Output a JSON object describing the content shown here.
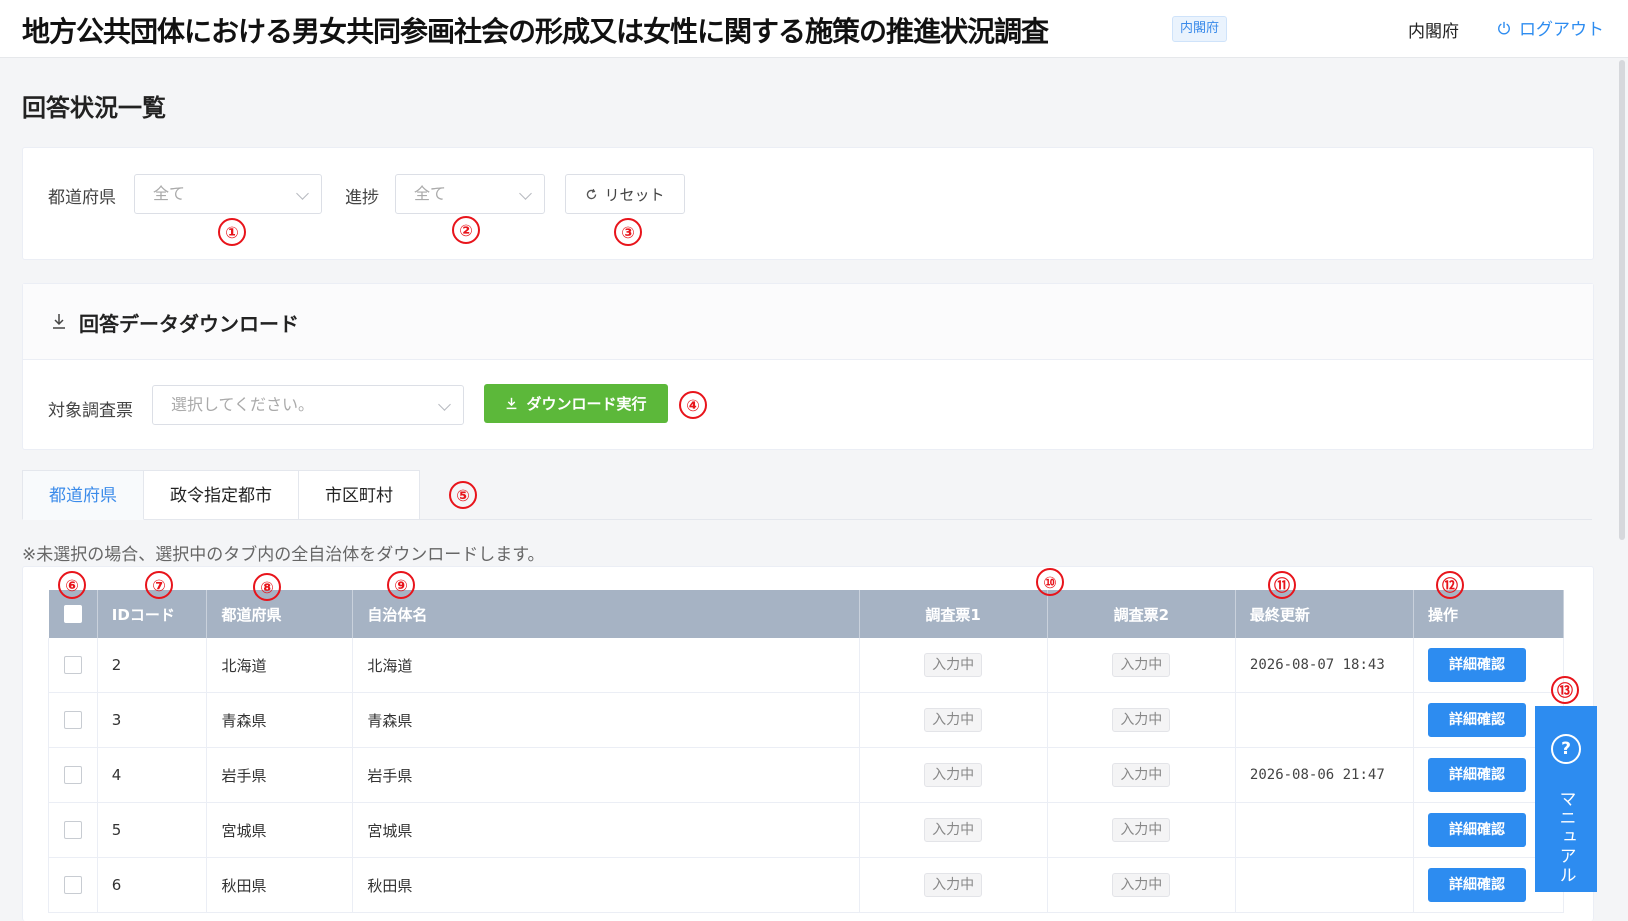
{
  "header": {
    "title": "地方公共団体における男女共同参画社会の形成又は女性に関する施策の推進状況調査",
    "badge": "内閣府",
    "org": "内閣府",
    "logout_label": "ログアウト"
  },
  "page": {
    "title": "回答状況一覧"
  },
  "filters": {
    "prefecture_label": "都道府県",
    "prefecture_value": "全て",
    "progress_label": "進捗",
    "progress_value": "全て",
    "reset_label": "リセット"
  },
  "download": {
    "title": "回答データダウンロード",
    "target_label": "対象調査票",
    "target_placeholder": "選択してください。",
    "execute_label": "ダウンロード実行"
  },
  "tabs": [
    {
      "label": "都道府県",
      "active": true
    },
    {
      "label": "政令指定都市",
      "active": false
    },
    {
      "label": "市区町村",
      "active": false
    }
  ],
  "note": "※未選択の場合、選択中のタブ内の全自治体をダウンロードします。",
  "table": {
    "headers": [
      "IDコード",
      "都道府県",
      "自治体名",
      "調査票1",
      "調査票2",
      "最終更新",
      "操作"
    ],
    "rows": [
      {
        "id": "2",
        "pref": "北海道",
        "name": "北海道",
        "s1": "入力中",
        "s2": "入力中",
        "updated": "2026-08-07 18:43",
        "action": "詳細確認"
      },
      {
        "id": "3",
        "pref": "青森県",
        "name": "青森県",
        "s1": "入力中",
        "s2": "入力中",
        "updated": "",
        "action": "詳細確認"
      },
      {
        "id": "4",
        "pref": "岩手県",
        "name": "岩手県",
        "s1": "入力中",
        "s2": "入力中",
        "updated": "2026-08-06 21:47",
        "action": "詳細確認"
      },
      {
        "id": "5",
        "pref": "宮城県",
        "name": "宮城県",
        "s1": "入力中",
        "s2": "入力中",
        "updated": "",
        "action": "詳細確認"
      },
      {
        "id": "6",
        "pref": "秋田県",
        "name": "秋田県",
        "s1": "入力中",
        "s2": "入力中",
        "updated": "",
        "action": "詳細確認"
      }
    ]
  },
  "manual": {
    "icon": "question-icon",
    "label": "マニュアル"
  },
  "annotations": [
    "①",
    "②",
    "③",
    "④",
    "⑤",
    "⑥",
    "⑦",
    "⑧",
    "⑨",
    "⑩",
    "⑪",
    "⑫",
    "⑬"
  ],
  "colors": {
    "primary": "#2d8cf0",
    "success": "#5cb83a",
    "annotation": "#e8141b",
    "table_header": "#a6b3c4"
  }
}
